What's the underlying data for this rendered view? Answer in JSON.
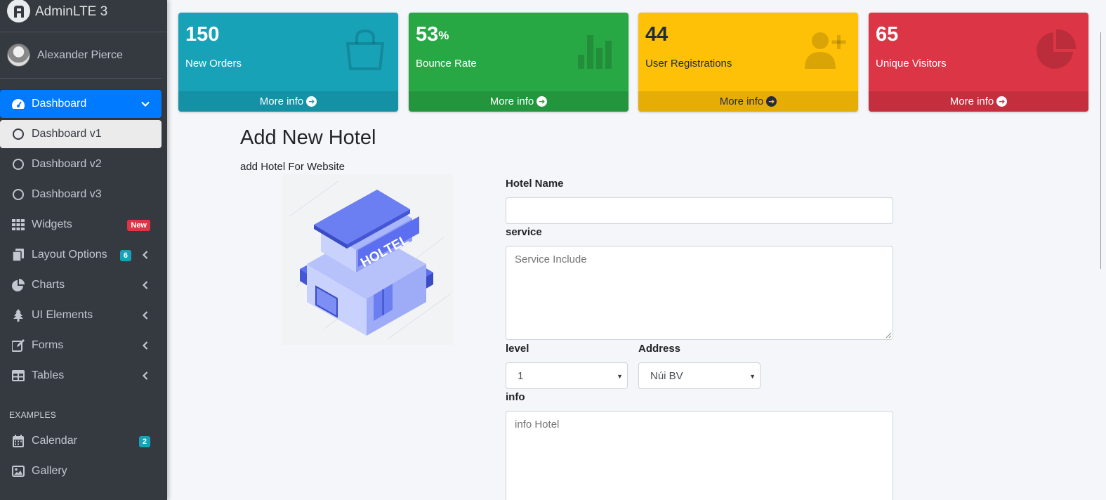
{
  "brand": {
    "text": "AdminLTE 3"
  },
  "user": {
    "name": "Alexander Pierce"
  },
  "sidebar": {
    "items": [
      {
        "label": "Dashboard",
        "icon": "tachometer-icon"
      },
      {
        "label": "Dashboard v1",
        "icon": "circle-icon"
      },
      {
        "label": "Dashboard v2",
        "icon": "circle-icon"
      },
      {
        "label": "Dashboard v3",
        "icon": "circle-icon"
      },
      {
        "label": "Widgets",
        "icon": "grid-icon",
        "badge": "New"
      },
      {
        "label": "Layout Options",
        "icon": "copy-icon",
        "badge": "6"
      },
      {
        "label": "Charts",
        "icon": "pie-chart-icon"
      },
      {
        "label": "UI Elements",
        "icon": "tree-icon"
      },
      {
        "label": "Forms",
        "icon": "edit-icon"
      },
      {
        "label": "Tables",
        "icon": "table-icon"
      }
    ],
    "header": "EXAMPLES",
    "examples": [
      {
        "label": "Calendar",
        "icon": "calendar-icon",
        "badge": "2"
      },
      {
        "label": "Gallery",
        "icon": "image-icon"
      }
    ]
  },
  "boxes": [
    {
      "value": "150",
      "label": "New Orders",
      "footer": "More info",
      "color": "#17a2b8",
      "icon": "shopping-bag-icon"
    },
    {
      "value": "53",
      "unit": "%",
      "label": "Bounce Rate",
      "footer": "More info",
      "color": "#28a745",
      "icon": "bar-chart-icon"
    },
    {
      "value": "44",
      "label": "User Registrations",
      "footer": "More info",
      "color": "#ffc107",
      "icon": "user-plus-icon"
    },
    {
      "value": "65",
      "label": "Unique Visitors",
      "footer": "More info",
      "color": "#dc3545",
      "icon": "pie-chart-icon"
    }
  ],
  "form": {
    "title": "Add New Hotel",
    "subtitle": "add Hotel For Website",
    "image_text": "HOLTEL",
    "hotel_name": {
      "label": "Hotel Name",
      "value": ""
    },
    "service": {
      "label": "service",
      "placeholder": "Service Include"
    },
    "level": {
      "label": "level",
      "selected": "1"
    },
    "address": {
      "label": "Address",
      "selected": "Núi BV"
    },
    "info": {
      "label": "info",
      "placeholder": "info Hotel"
    }
  }
}
